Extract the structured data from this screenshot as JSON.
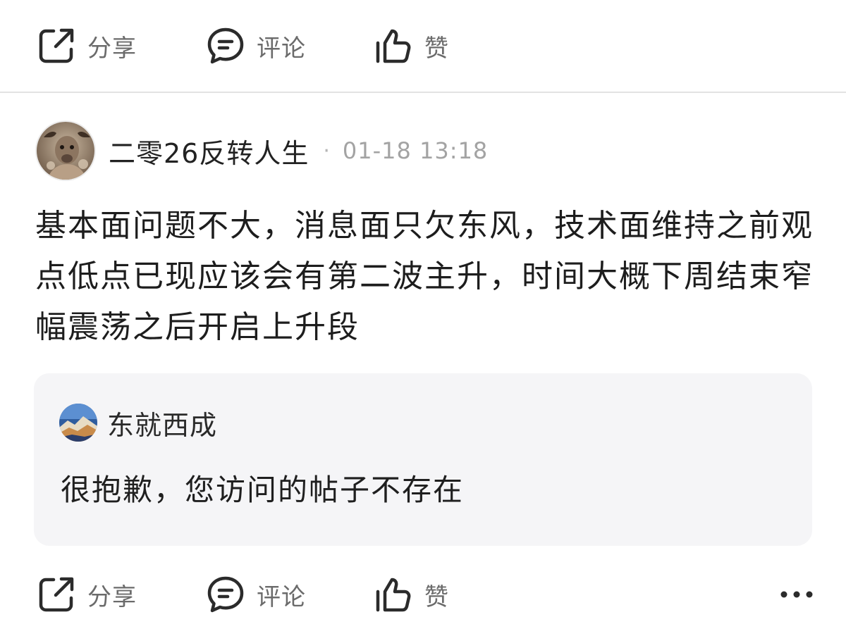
{
  "top_actions": {
    "share_label": "分享",
    "comment_label": "评论",
    "like_label": "赞"
  },
  "post": {
    "author": "二零26反转人生",
    "separator": "·",
    "time": "01-18 13:18",
    "body": "基本面问题不大，消息面只欠东风，技术面维持之前观点低点已现应该会有第二波主升，时间大概下周结束窄幅震荡之后开启上升段"
  },
  "quote": {
    "author": "东就西成",
    "text": "很抱歉，您访问的帖子不存在"
  },
  "bottom_actions": {
    "share_label": "分享",
    "comment_label": "评论",
    "like_label": "赞"
  },
  "colors": {
    "icon": "#2b2b2b",
    "label": "#6b6b6b",
    "card_bg": "#f5f5f7",
    "divider": "#e3e3e3"
  }
}
